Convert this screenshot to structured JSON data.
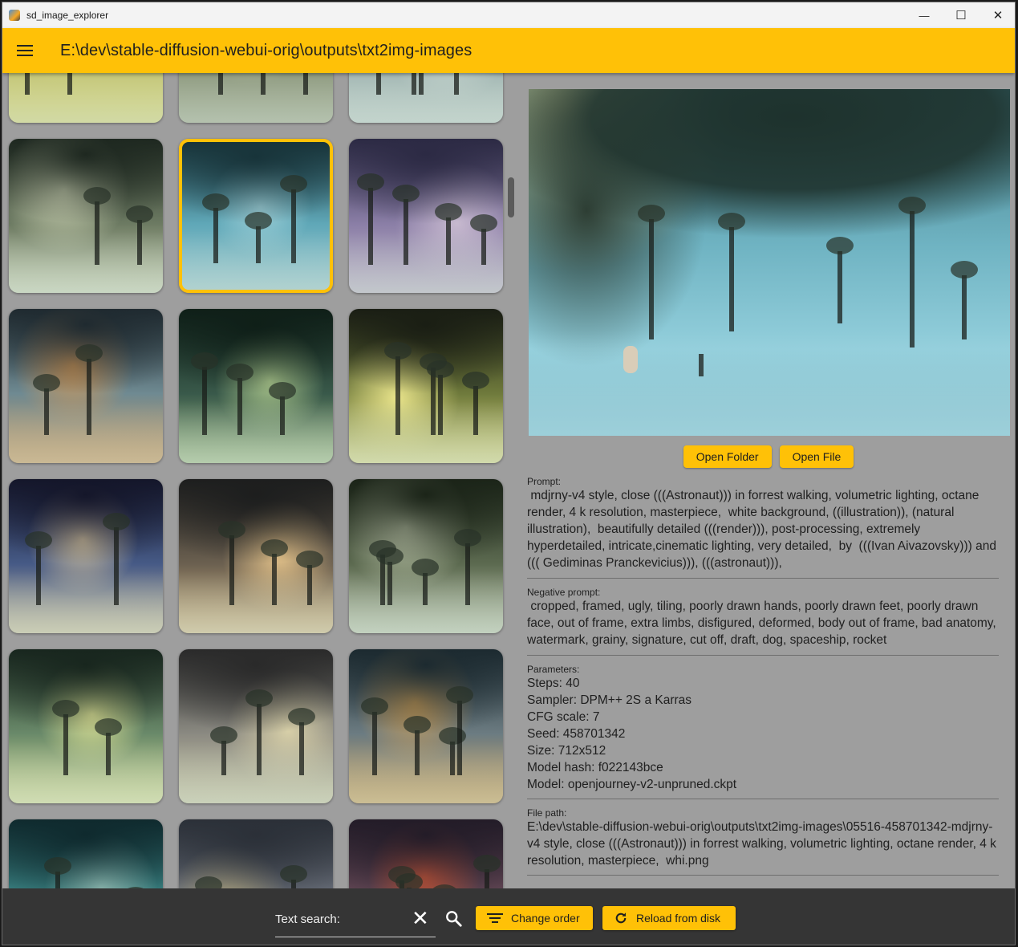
{
  "window": {
    "title": "sd_image_explorer",
    "minimize_glyph": "—",
    "maximize_glyph": "☐",
    "close_glyph": "✕"
  },
  "appbar": {
    "path": "E:\\dev\\stable-diffusion-webui-orig\\outputs\\txt2img-images"
  },
  "buttons": {
    "open_folder": "Open Folder",
    "open_file": "Open File"
  },
  "prompt": {
    "label": "Prompt:",
    "text": " mdjrny-v4 style, close (((Astronaut))) in forrest walking, volumetric lighting, octane render, 4 k resolution, masterpiece,  white background, ((illustration)), (natural illustration),  beautifully detailed (((render))), post-processing, extremely hyperdetailed, intricate,cinematic lighting, very detailed,  by  (((Ivan Aivazovsky))) and ((( Gediminas Pranckevicius))), (((astronaut))),"
  },
  "negative_prompt": {
    "label": "Negative prompt:",
    "text": " cropped, framed, ugly, tiling, poorly drawn hands, poorly drawn feet, poorly drawn face, out of frame, extra limbs, disfigured, deformed, body out of frame, bad anatomy, watermark, grainy, signature, cut off, draft, dog, spaceship, rocket"
  },
  "parameters": {
    "label": "Parameters:",
    "lines": [
      "Steps: 40",
      "Sampler: DPM++ 2S a Karras",
      "CFG scale: 7",
      "Seed: 458701342",
      "Size: 712x512",
      "Model hash: f022143bce",
      "Model: openjourney-v2-unpruned.ckpt"
    ]
  },
  "file_path": {
    "label": "File path:",
    "text": "E:\\dev\\stable-diffusion-webui-orig\\outputs\\txt2img-images\\05516-458701342-mdjrny-v4 style, close (((Astronaut))) in forrest walking, volumetric lighting, octane render, 4 k resolution, masterpiece,  whi.png"
  },
  "bottombar": {
    "search_label": "Text search:",
    "clear_glyph": "✕",
    "change_order": "Change order",
    "reload": "Reload from disk"
  },
  "colors": {
    "accent": "#ffc107",
    "background": "#9e9e9e",
    "bottom_bar": "#353535"
  },
  "thumbnails": [
    {
      "row": 0,
      "col": 0,
      "colors": [
        "#5e6a45",
        "#b5b86a",
        "#e8e27a"
      ]
    },
    {
      "row": 0,
      "col": 1,
      "colors": [
        "#3c4a3c",
        "#7d8a6f",
        "#a7ad8e"
      ]
    },
    {
      "row": 0,
      "col": 2,
      "colors": [
        "#2a3a38",
        "#8fa6a4",
        "#c8d6d1"
      ]
    },
    {
      "row": 1,
      "col": 0,
      "colors": [
        "#1e2820",
        "#6c7a62",
        "#d6dcbc"
      ]
    },
    {
      "row": 1,
      "col": 1,
      "colors": [
        "#18343a",
        "#5fa7b7",
        "#9fd0d8"
      ],
      "selected": true
    },
    {
      "row": 1,
      "col": 2,
      "colors": [
        "#2c2a44",
        "#8a7ea6",
        "#c7b9cf"
      ]
    },
    {
      "row": 2,
      "col": 0,
      "colors": [
        "#1f2a30",
        "#6f8a92",
        "#d79a56"
      ]
    },
    {
      "row": 2,
      "col": 1,
      "colors": [
        "#0f1f18",
        "#39594a",
        "#a9c48b"
      ]
    },
    {
      "row": 2,
      "col": 2,
      "colors": [
        "#1a1e14",
        "#6f7a3c",
        "#e8e38a"
      ]
    },
    {
      "row": 3,
      "col": 0,
      "colors": [
        "#14162a",
        "#465a86",
        "#d8c7a0"
      ]
    },
    {
      "row": 3,
      "col": 1,
      "colors": [
        "#1d1e1e",
        "#6b6050",
        "#e3c28a"
      ]
    },
    {
      "row": 3,
      "col": 2,
      "colors": [
        "#1b2418",
        "#5c6a50",
        "#c7cfb4"
      ]
    },
    {
      "row": 4,
      "col": 0,
      "colors": [
        "#18261e",
        "#6a8a6a",
        "#e4e89a"
      ]
    },
    {
      "row": 4,
      "col": 1,
      "colors": [
        "#2a2a2a",
        "#8b8a82",
        "#d7cfa8"
      ]
    },
    {
      "row": 4,
      "col": 2,
      "colors": [
        "#1c2a30",
        "#6c7c82",
        "#d9a455"
      ]
    },
    {
      "row": 5,
      "col": 0,
      "colors": [
        "#0f2a2e",
        "#3f8c8c",
        "#a4d3c9"
      ]
    },
    {
      "row": 5,
      "col": 1,
      "colors": [
        "#2b3038",
        "#6f7580",
        "#c4b78a"
      ]
    },
    {
      "row": 5,
      "col": 2,
      "colors": [
        "#231c28",
        "#6a4c5a",
        "#e0603c"
      ]
    }
  ]
}
